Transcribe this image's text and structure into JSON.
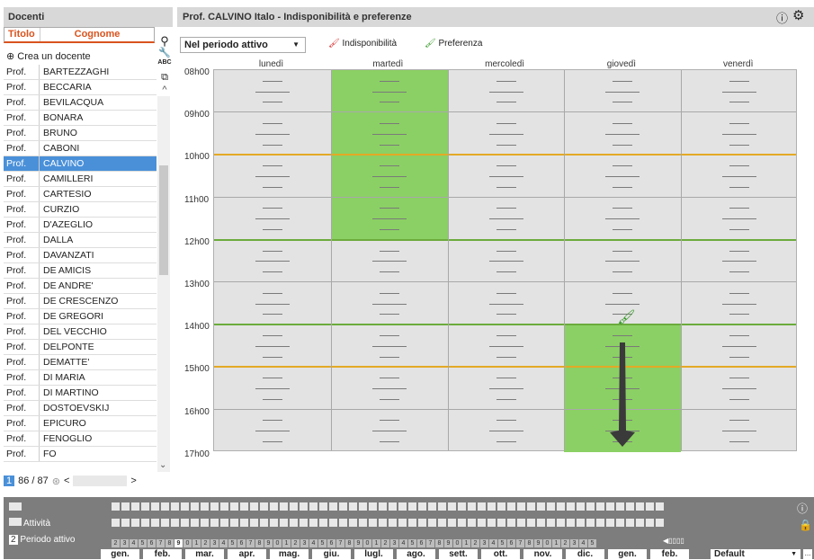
{
  "left_panel": {
    "title": "Docenti",
    "col_title": "Titolo",
    "col_surname": "Cognome",
    "create_label": "Crea un docente",
    "pager": "86 / 87",
    "page": "1"
  },
  "teachers": [
    {
      "t": "Prof.",
      "n": "BARTEZZAGHI"
    },
    {
      "t": "Prof.",
      "n": "BECCARIA"
    },
    {
      "t": "Prof.",
      "n": "BEVILACQUA"
    },
    {
      "t": "Prof.",
      "n": "BONARA"
    },
    {
      "t": "Prof.",
      "n": "BRUNO"
    },
    {
      "t": "Prof.",
      "n": "CABONI"
    },
    {
      "t": "Prof.",
      "n": "CALVINO"
    },
    {
      "t": "Prof.",
      "n": "CAMILLERI"
    },
    {
      "t": "Prof.",
      "n": "CARTESIO"
    },
    {
      "t": "Prof.",
      "n": "CURZIO"
    },
    {
      "t": "Prof.",
      "n": "D'AZEGLIO"
    },
    {
      "t": "Prof.",
      "n": "DALLA"
    },
    {
      "t": "Prof.",
      "n": "DAVANZATI"
    },
    {
      "t": "Prof.",
      "n": "DE AMICIS"
    },
    {
      "t": "Prof.",
      "n": "DE ANDRE'"
    },
    {
      "t": "Prof.",
      "n": "DE CRESCENZO"
    },
    {
      "t": "Prof.",
      "n": "DE GREGORI"
    },
    {
      "t": "Prof.",
      "n": "DEL VECCHIO"
    },
    {
      "t": "Prof.",
      "n": "DELPONTE"
    },
    {
      "t": "Prof.",
      "n": "DEMATTE'"
    },
    {
      "t": "Prof.",
      "n": "DI MARIA"
    },
    {
      "t": "Prof.",
      "n": "DI MARTINO"
    },
    {
      "t": "Prof.",
      "n": "DOSTOEVSKIJ"
    },
    {
      "t": "Prof.",
      "n": "EPICURO"
    },
    {
      "t": "Prof.",
      "n": "FENOGLIO"
    },
    {
      "t": "Prof.",
      "n": "FO"
    }
  ],
  "selected_teacher": "CALVINO",
  "right_panel": {
    "title": "Prof. CALVINO Italo - Indisponibilità e preferenze",
    "period": "Nel periodo attivo",
    "unavail": "Indisponibilità",
    "pref": "Preferenza"
  },
  "days": [
    "lunedì",
    "martedì",
    "mercoledì",
    "giovedì",
    "venerdì"
  ],
  "hours": [
    "08h00",
    "09h00",
    "10h00",
    "11h00",
    "12h00",
    "13h00",
    "14h00",
    "15h00",
    "16h00",
    "17h00"
  ],
  "marked_slots": [
    {
      "day": "martedì",
      "from": "08h00",
      "to": "12h00"
    },
    {
      "day": "giovedì",
      "from": "14h00",
      "to": "17h00"
    }
  ],
  "bottom": {
    "row2": "Attività",
    "row3_num": "2",
    "row3": "Periodo attivo",
    "selected_week": "9",
    "select": "Default",
    "weeks": [
      "2",
      "3",
      "4",
      "5",
      "6",
      "7",
      "8",
      "9",
      "0",
      "1",
      "2",
      "3",
      "4",
      "5",
      "6",
      "7",
      "8",
      "9",
      "0",
      "1",
      "2",
      "3",
      "4",
      "5",
      "6",
      "7",
      "8",
      "9",
      "0",
      "1",
      "2",
      "3",
      "4",
      "5",
      "6",
      "7",
      "8",
      "9",
      "0",
      "1",
      "2",
      "3",
      "4",
      "5",
      "6",
      "7",
      "8",
      "9",
      "0",
      "1",
      "2",
      "3",
      "4",
      "5"
    ]
  },
  "months": [
    "gen.",
    "feb.",
    "mar.",
    "apr.",
    "mag.",
    "giu.",
    "lugl.",
    "ago.",
    "sett.",
    "ott.",
    "nov.",
    "dic.",
    "gen.",
    "feb."
  ],
  "colors": {
    "accent": "#d9531e",
    "selected": "#4a90d9",
    "green": "#8bd064",
    "yellow_line": "#e3a925",
    "green_line": "#6cab3c"
  }
}
